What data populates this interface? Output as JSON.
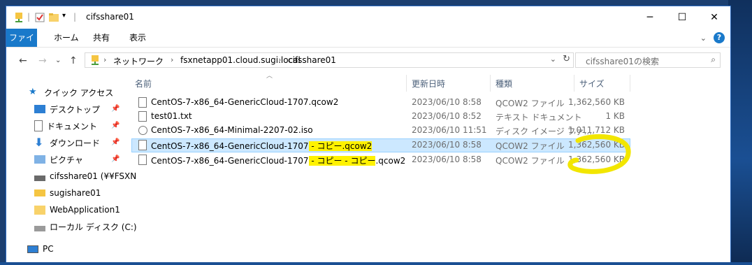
{
  "window": {
    "title": "cifsshare01"
  },
  "ribbon": {
    "tabs": [
      "ファイル",
      "ホーム",
      "共有",
      "表示"
    ]
  },
  "address": {
    "crumbs": [
      "ネットワーク",
      "fsxnetapp01.cloud.sugi.local",
      "cifsshare01"
    ],
    "search_placeholder": "cifsshare01の検索"
  },
  "columns": {
    "name": "名前",
    "date": "更新日時",
    "type": "種類",
    "size": "サイズ"
  },
  "navpane": {
    "quick_access": "クイック アクセス",
    "items": [
      "デスクトップ",
      "ドキュメント",
      "ダウンロード",
      "ピクチャ",
      "cifsshare01 (¥¥FSXN",
      "sugishare01",
      "WebApplication1",
      "ローカル ディスク (C:)"
    ],
    "pc": "PC"
  },
  "files": [
    {
      "name": "CentOS-7-x86_64-GenericCloud-1707.qcow2",
      "date": "2023/06/10 8:58",
      "type": "QCOW2 ファイル",
      "size": "1,362,560 KB"
    },
    {
      "name": "test01.txt",
      "date": "2023/06/10 8:52",
      "type": "テキスト ドキュメント",
      "size": "1 KB"
    },
    {
      "name": "CentOS-7-x86_64-Minimal-2207-02.iso",
      "date": "2023/06/10 11:51",
      "type": "ディスク イメージ ファ...",
      "size": "1,011,712 KB"
    },
    {
      "name_base": "CentOS-7-x86_64-GenericCloud-1707",
      "name_suffix": " - コピー.qcow2",
      "date": "2023/06/10 8:58",
      "type": "QCOW2 ファイル",
      "size": "1,362,560 KB"
    },
    {
      "name_base": "CentOS-7-x86_64-GenericCloud-1707",
      "name_suffix": " - コピー - コピー",
      "name_ext": ".qcow2",
      "date": "2023/06/10 8:58",
      "type": "QCOW2 ファイル",
      "size": "1,362,560 KB"
    }
  ],
  "colors": {
    "selection": "#cce8ff",
    "highlight": "#fff200",
    "accent": "#1979ca"
  }
}
